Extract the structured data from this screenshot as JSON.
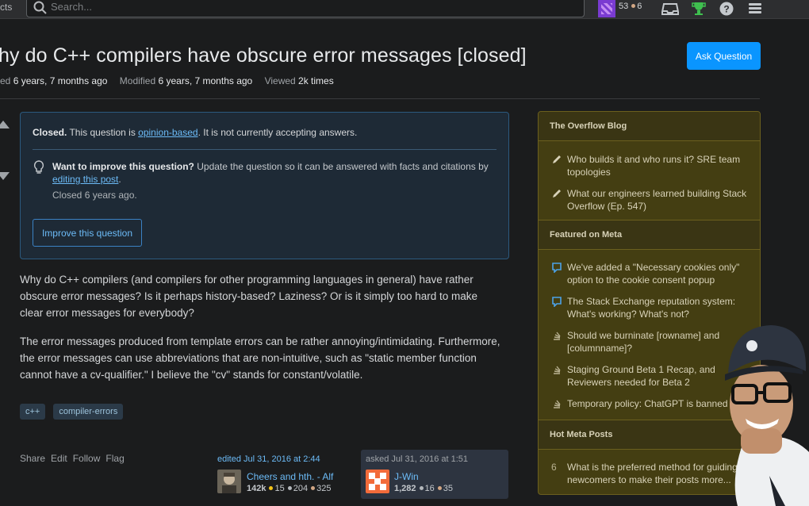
{
  "topbar": {
    "left_cut_text": "cts",
    "search_placeholder": "Search...",
    "reputation": "53",
    "bronze_count": "6"
  },
  "question": {
    "title": "hy do C++ compilers have obscure error messages [closed]",
    "asked_label": "ed",
    "asked_value": "6 years, 7 months ago",
    "modified_label": "Modified",
    "modified_value": "6 years, 7 months ago",
    "viewed_label": "Viewed",
    "viewed_value": "2k times",
    "ask_button": "Ask Question"
  },
  "notice": {
    "closed_bold": "Closed.",
    "closed_text_a": " This question is ",
    "closed_link": "opinion-based",
    "closed_text_b": ". It is not currently accepting answers.",
    "want_bold": "Want to improve this question?",
    "want_text": " Update the question so it can be answered with facts and citations by ",
    "want_link": "editing this post",
    "want_end": ".",
    "closed_ago": "Closed 6 years ago.",
    "improve_button": "Improve this question"
  },
  "body": {
    "p1": "Why do C++ compilers (and compilers for other programming languages in general) have rather obscure error messages? Is it perhaps history-based? Laziness? Or is it simply too hard to make clear error messages for everybody?",
    "p2": "The error messages produced from template errors can be rather annoying/intimidating. Furthermore, the error messages can use abbreviations that are non-intuitive, such as \"static member function cannot have a cv-qualifier.\" I believe the \"cv\" stands for constant/volatile."
  },
  "tags": [
    "c++",
    "compiler-errors"
  ],
  "post_menu": [
    "Share",
    "Edit",
    "Follow",
    "Flag"
  ],
  "edited": {
    "when": "edited Jul 31, 2016 at 2:44",
    "user": "Cheers and hth. - Alf",
    "rep": "142k",
    "gold": "15",
    "silver": "204",
    "bronze": "325"
  },
  "asked": {
    "when": "asked Jul 31, 2016 at 1:51",
    "user": "J-Win",
    "rep": "1,282",
    "silver": "16",
    "bronze": "35"
  },
  "sidebar": {
    "blog_heading": "The Overflow Blog",
    "blog_items": [
      "Who builds it and who runs it? SRE team topologies",
      "What our engineers learned building Stack Overflow (Ep. 547)"
    ],
    "meta_heading": "Featured on Meta",
    "meta_items": [
      "We've added a \"Necessary cookies only\" option to the cookie consent popup",
      "The Stack Exchange reputation system: What's working? What's not?",
      "Should we burninate [rowname] and [columnname]?",
      "Staging Ground Beta 1 Recap, and Reviewers needed for Beta 2",
      "Temporary policy: ChatGPT is banned"
    ],
    "hot_heading": "Hot Meta Posts",
    "hot_items": [
      {
        "count": "6",
        "text": "What is the preferred method for guiding newcomers to make their posts more..."
      }
    ]
  },
  "colors": {
    "accent": "#0a95ff",
    "link": "#6cbbf7",
    "sidebar_bg": "#443e12"
  }
}
